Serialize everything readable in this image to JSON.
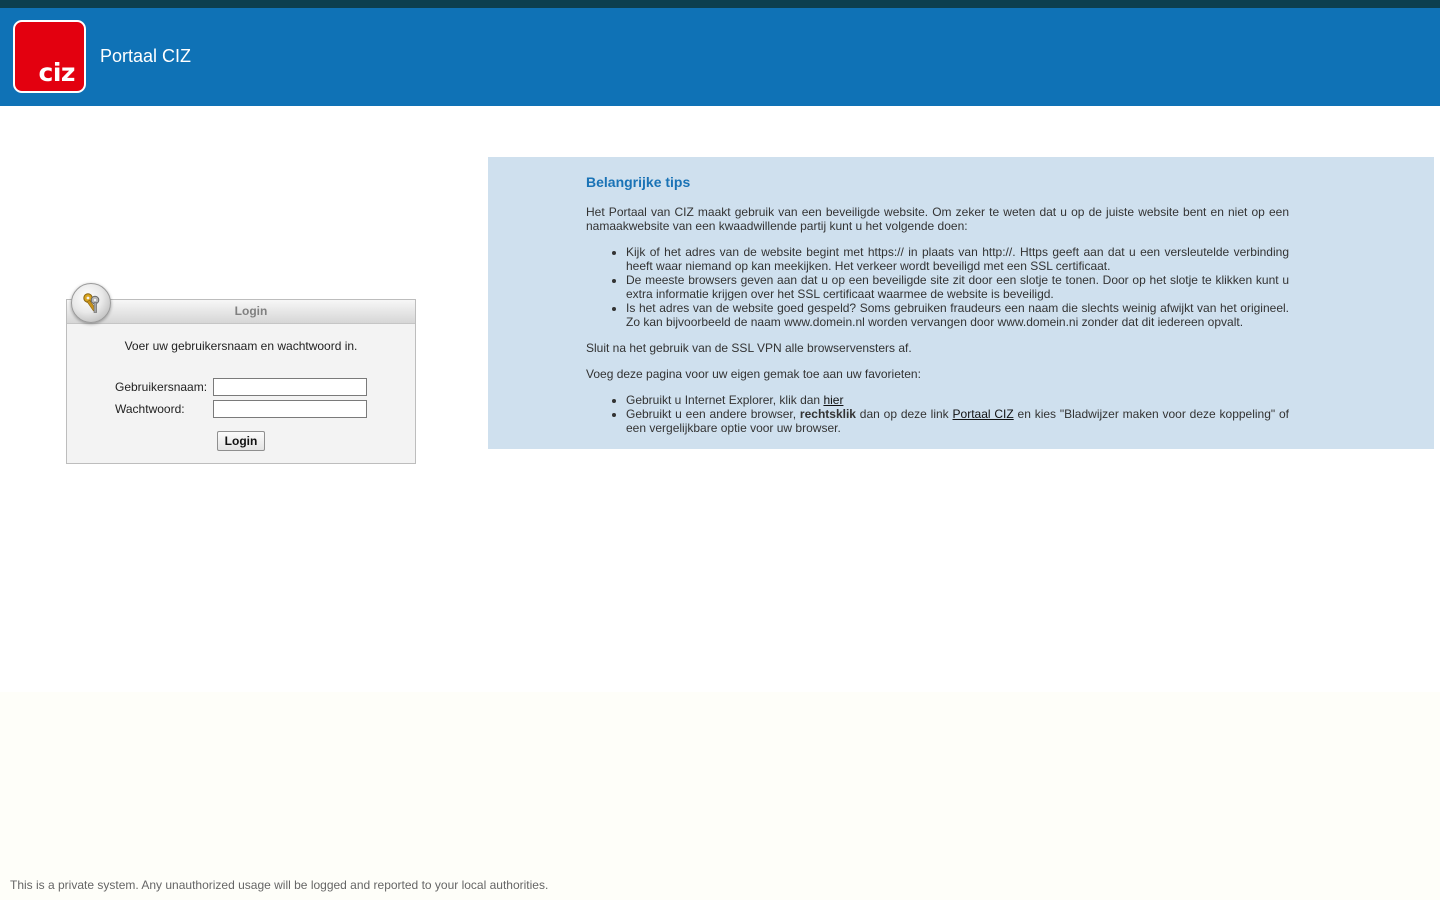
{
  "header": {
    "logo_text": "ciz",
    "title": "Portaal CIZ"
  },
  "login": {
    "title": "Login",
    "icon": "keys-icon",
    "instruction": "Voer uw gebruikersnaam en wachtwoord in.",
    "username_label": "Gebruikersnaam:",
    "username_value": "",
    "password_label": "Wachtwoord:",
    "password_value": "",
    "button_label": "Login"
  },
  "tips": {
    "title": "Belangrijke tips",
    "intro": "Het Portaal van CIZ maakt gebruik van een beveiligde website. Om zeker te weten dat u op de juiste website bent en niet op een namaakwebsite van een kwaadwillende partij kunt u het volgende doen:",
    "items": [
      "Kijk of het adres van de website begint met https:// in plaats van http://. Https geeft aan dat u een versleutelde verbinding heeft waar niemand op kan meekijken. Het verkeer wordt beveiligd met een SSL certificaat.",
      "De meeste browsers geven aan dat u op een beveiligde site zit door een slotje te tonen. Door op het slotje te klikken kunt u extra informatie krijgen over het SSL certificaat waarmee de website is beveiligd.",
      "Is het adres van de website goed gespeld? Soms gebruiken fraudeurs een naam die slechts weinig afwijkt van het origineel. Zo kan bijvoorbeeld de naam www.domein.nl worden vervangen door www.domein.ni zonder dat dit iedereen opvalt."
    ],
    "close_note": "Sluit na het gebruik van de SSL VPN alle browservensters af.",
    "favorites_intro": "Voeg deze pagina voor uw eigen gemak toe aan uw favorieten:",
    "fav_ie_text": "Gebruikt u Internet Explorer, klik dan ",
    "fav_ie_link": "hier",
    "fav_other_text1": "Gebruikt u een andere browser, ",
    "fav_other_bold": "rechtsklik",
    "fav_other_text2": " dan op deze link ",
    "fav_other_link": "Portaal CIZ",
    "fav_other_text3": " en kies \"Bladwijzer maken voor deze koppeling\" of een vergelijkbare optie voor uw browser."
  },
  "footer": {
    "text": "This is a private system. Any unauthorized usage will be logged and reported to your local authorities."
  },
  "colors": {
    "header_bg": "#0f72b6",
    "top_strip": "#0c3f4f",
    "logo_bg": "#e3000f",
    "tips_bg": "#cfe0ee",
    "tips_title": "#1a73b6"
  }
}
